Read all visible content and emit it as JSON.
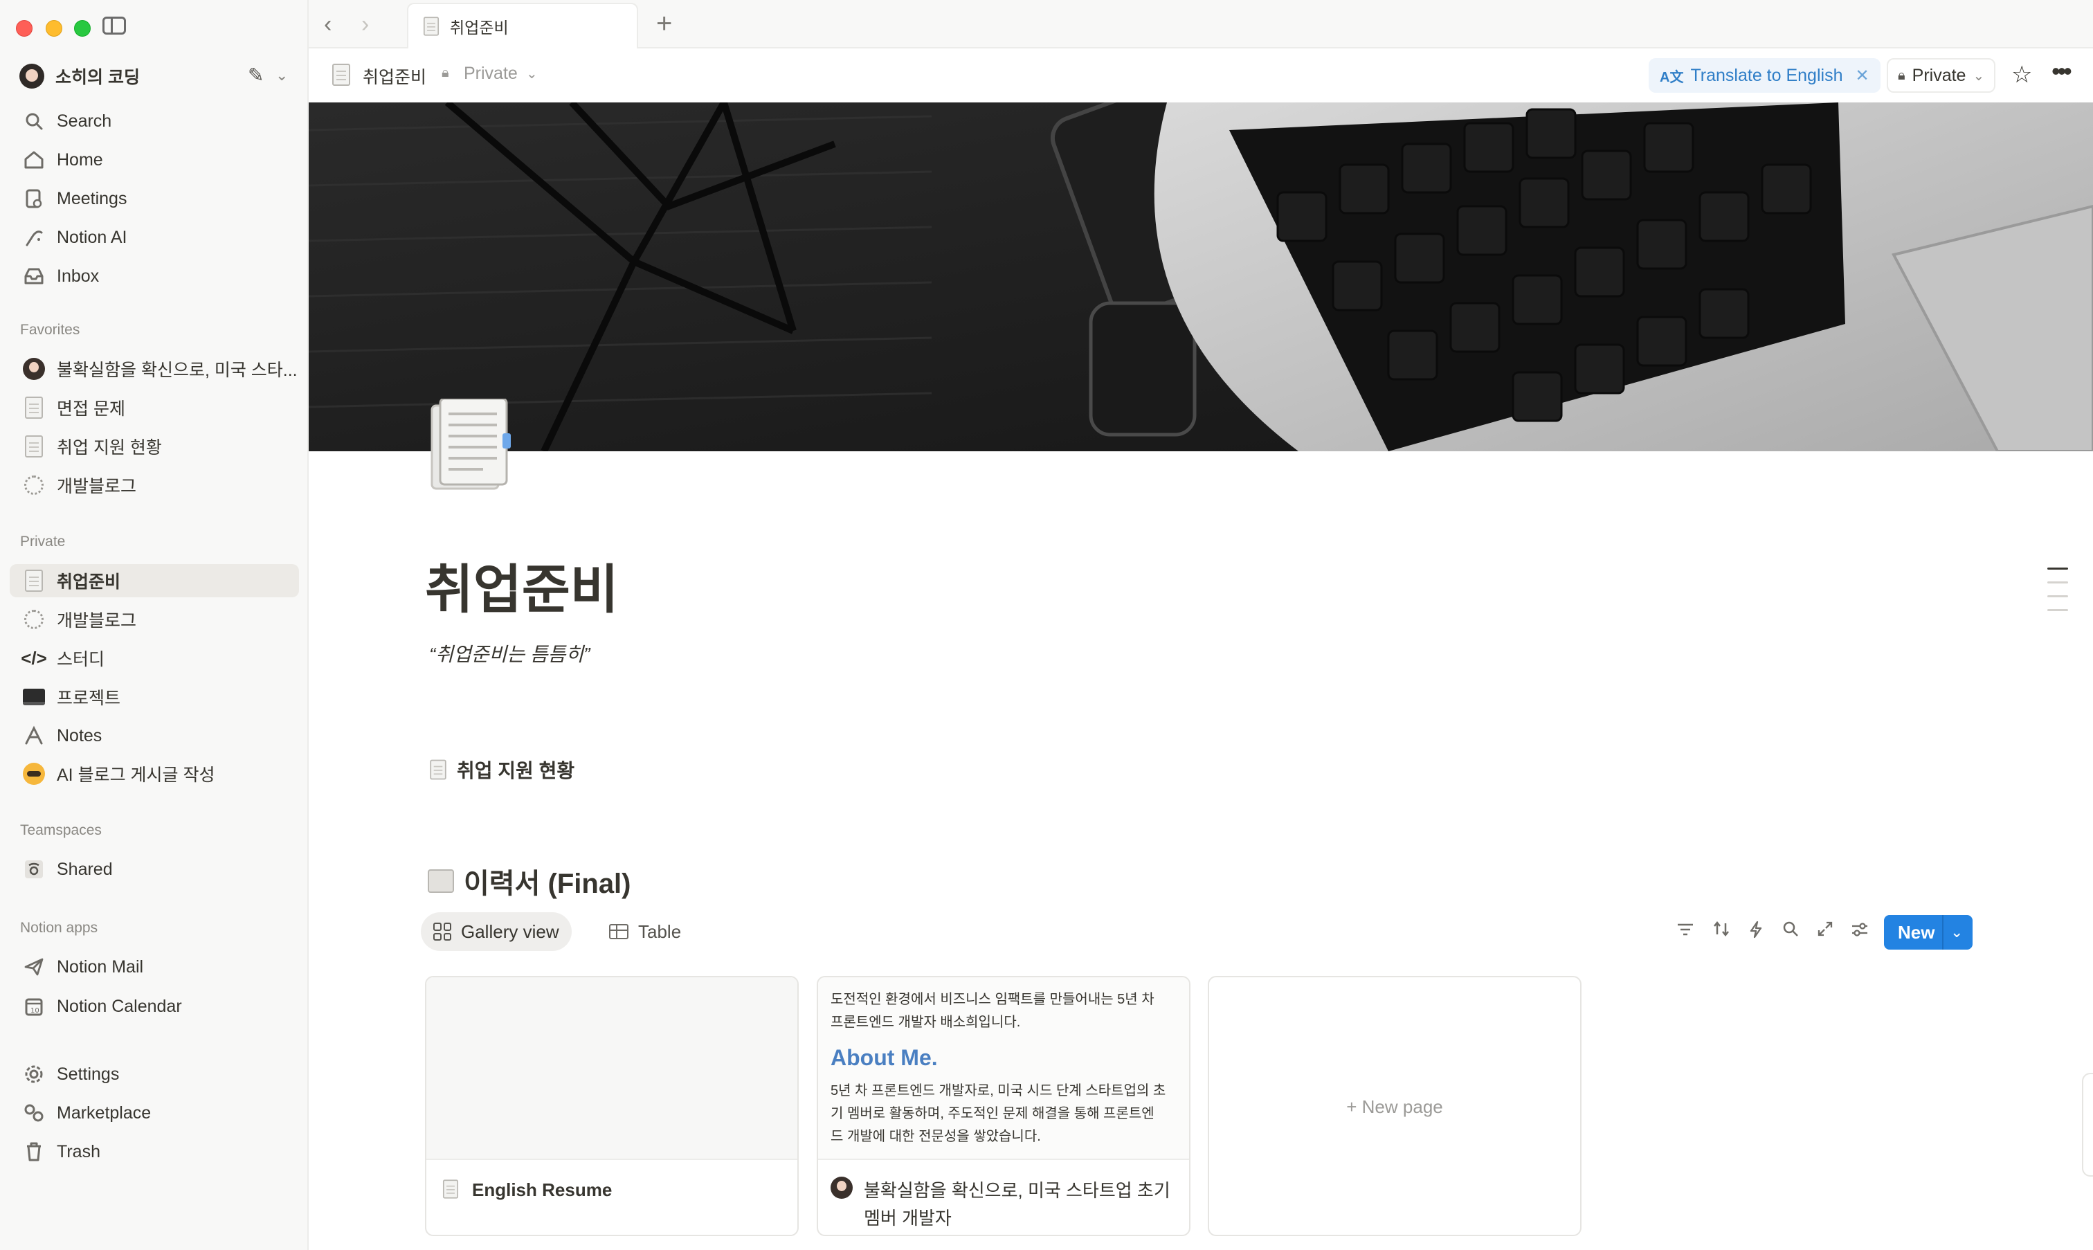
{
  "workspace": {
    "name": "소히의 코딩"
  },
  "nav": {
    "search": "Search",
    "home": "Home",
    "meetings": "Meetings",
    "notion_ai": "Notion AI",
    "inbox": "Inbox"
  },
  "favorites": {
    "label": "Favorites",
    "items": [
      "불확실함을 확신으로, 미국 스타...",
      "면접 문제",
      "취업 지원 현황",
      "개발블로그"
    ]
  },
  "private": {
    "label": "Private",
    "items": [
      "취업준비",
      "개발블로그",
      "스터디",
      "프로젝트",
      "Notes",
      "AI 블로그 게시글 작성"
    ]
  },
  "teamspaces": {
    "label": "Teamspaces",
    "items": [
      "Shared"
    ]
  },
  "notion_apps": {
    "label": "Notion apps",
    "items": [
      "Notion Mail",
      "Notion Calendar"
    ]
  },
  "bottom_nav": {
    "settings": "Settings",
    "marketplace": "Marketplace",
    "trash": "Trash"
  },
  "tab": {
    "title": "취업준비"
  },
  "header": {
    "title": "취업준비",
    "visibility": "Private",
    "translate": "Translate to English",
    "share": "Private"
  },
  "page": {
    "title": "취업준비",
    "quote": "“취업준비는 틈틈히”",
    "linked_page": "취업 지원 현황",
    "database_title": "이력서 (Final)"
  },
  "views": {
    "gallery": "Gallery view",
    "table": "Table"
  },
  "toolbar": {
    "new_label": "New"
  },
  "cards": [
    {
      "title": "English Resume"
    },
    {
      "preview_line1": "도전적인 환경에서 비즈니스 임팩트를 만들어내는 5년 차",
      "preview_line2": "프론트엔드 개발자 배소희입니다.",
      "preview_heading": "About Me.",
      "preview_line3": "5년 차 프론트엔드 개발자로, 미국 시드 단계 스타트업의 초",
      "preview_line4": "기 멤버로 활동하며, 주도적인 문제 해결을 통해 프론트엔",
      "preview_line5": "드 개발에 대한 전문성을 쌓았습니다.",
      "title": "불확실함을 확신으로, 미국 스타트업 초기 멤버 개발자"
    },
    {
      "new_page": "+ New page"
    }
  ],
  "colors": {
    "accent": "#2383e2",
    "translate": "#2f7ec7",
    "sidebar_bg": "#f8f8f7",
    "preview_heading": "#4a7fc1"
  }
}
